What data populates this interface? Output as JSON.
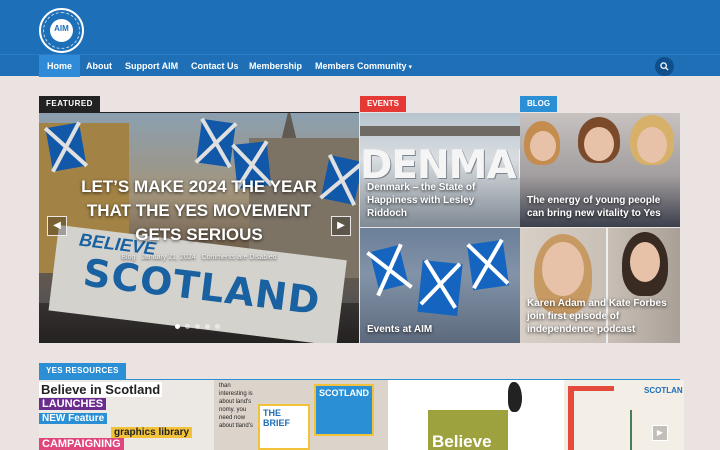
{
  "header": {
    "logo_text": "AIM",
    "logo_ring_text": "Alliance for Independence Movement"
  },
  "nav": {
    "items": [
      {
        "label": "Home",
        "active": true
      },
      {
        "label": "About"
      },
      {
        "label": "Support AIM"
      },
      {
        "label": "Contact Us"
      },
      {
        "label": "Membership"
      },
      {
        "label": "Members Community",
        "has_dropdown": true
      }
    ],
    "search_icon": "search-icon"
  },
  "sections": {
    "featured": "FEATURED",
    "events": "EVENTS",
    "blog": "BLOG",
    "yes_resources": "YES RESOURCES"
  },
  "slider": {
    "title": "LET’S MAKE 2024 THE YEAR THAT THE YES MOVEMENT GETS SERIOUS",
    "meta_category": "Blog",
    "meta_date": "January 21, 2024",
    "meta_comments": "Comments are Disabled",
    "banner_text": "SCOTLAND",
    "banner_text_top": "BELIEVE",
    "prev_icon": "chevron-left-icon",
    "next_icon": "chevron-right-icon",
    "slide_count": 5,
    "active_slide": 0
  },
  "tiles": {
    "denmark": {
      "image_text": "DENMARK",
      "title": "Denmark – the State of Happiness with Lesley Riddoch"
    },
    "blog1": {
      "title": "The energy of young people can bring new vitality to Yes"
    },
    "events": {
      "title": "Events at AIM"
    },
    "blog2": {
      "title": "Karen Adam and Kate Forbes join first episode of independence podcast"
    }
  },
  "resources": {
    "r1": {
      "line1": "Believe in Scotland",
      "line2": "LAUNCHES",
      "line3": "NEW Feature",
      "line4": "graphics library",
      "line5": "CAMPAIGNING"
    },
    "r2": {
      "text": "than interesting is about land's nomy. you need now about tland's",
      "card1": "SCOTLAND",
      "card2": "THE BRIEF"
    },
    "r3": {
      "word": "Believe"
    },
    "r4": {
      "text": "SCOTLAN"
    }
  },
  "colors": {
    "brand_blue": "#1d6fb8",
    "nav_active": "#2f8bd8",
    "events_red": "#e53935",
    "blog_blue": "#2b8fd6",
    "featured_black": "#222222"
  }
}
